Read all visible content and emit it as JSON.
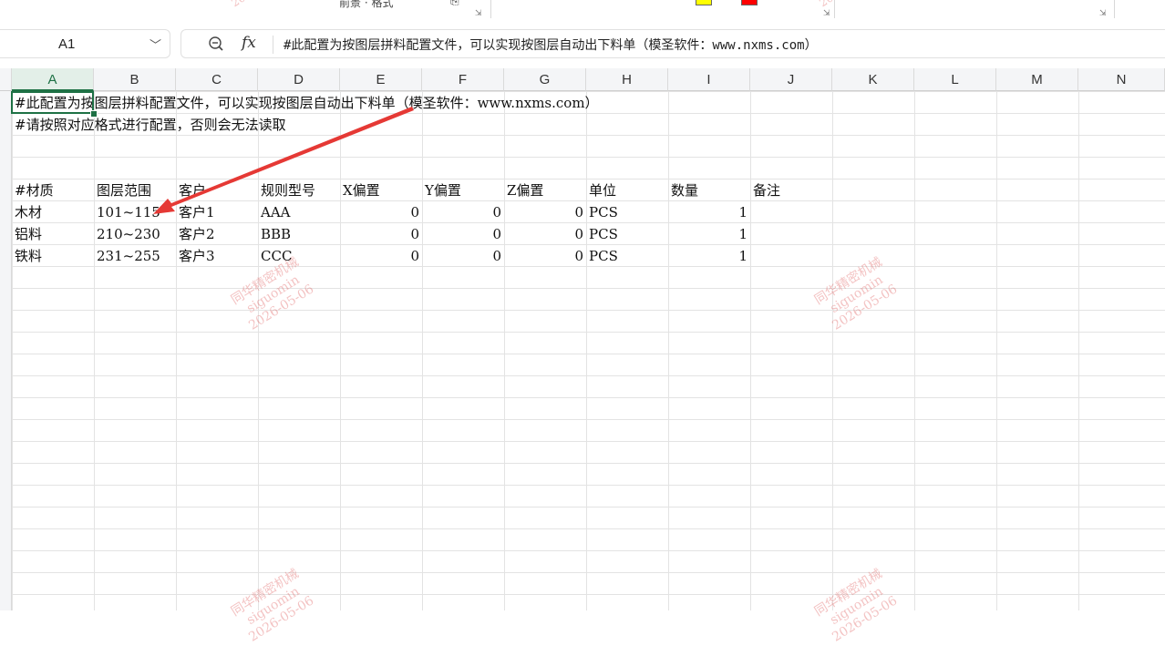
{
  "ribbon": {
    "fragments": [
      "前景 · 格式",
      "⎘",
      "⇲",
      "⇲",
      "⇲"
    ],
    "swatch_colors": [
      "#ffff00",
      "#ff0000"
    ]
  },
  "formula_bar": {
    "name_box": "A1",
    "zoom_icon": "magnifier-minus-icon",
    "fx_label": "fx",
    "content": "#此配置为按图层拼料配置文件，可以实现按图层自动出下料单（模圣软件：www.nxms.com）"
  },
  "grid": {
    "columns": [
      "A",
      "B",
      "C",
      "D",
      "E",
      "F",
      "G",
      "H",
      "I",
      "J",
      "K",
      "L",
      "M",
      "N"
    ],
    "selected_column": "A",
    "selected_cell": "A1",
    "rows": {
      "r1": "#此配置为按图层拼料配置文件，可以实现按图层自动出下料单（模圣软件：www.nxms.com）",
      "r2": "#请按照对应格式进行配置，否则会无法读取",
      "header": [
        "#材质",
        "图层范围",
        "客户",
        "规则型号",
        "X偏置",
        "Y偏置",
        "Z偏置",
        "单位",
        "数量",
        "备注"
      ],
      "data": [
        [
          "木材",
          "101~115",
          "客户1",
          "AAA",
          "0",
          "0",
          "0",
          "PCS",
          "1"
        ],
        [
          "铝料",
          "210~230",
          "客户2",
          "BBB",
          "0",
          "0",
          "0",
          "PCS",
          "1"
        ],
        [
          "铁料",
          "231~255",
          "客户3",
          "CCC",
          "0",
          "0",
          "0",
          "PCS",
          "1"
        ]
      ]
    }
  },
  "watermark": {
    "line1": "同华精密机械",
    "line2": "siguomin",
    "line3": "2026-05-06",
    "color": "#dc5050"
  },
  "annotation": {
    "arrow_color": "#e53935"
  }
}
